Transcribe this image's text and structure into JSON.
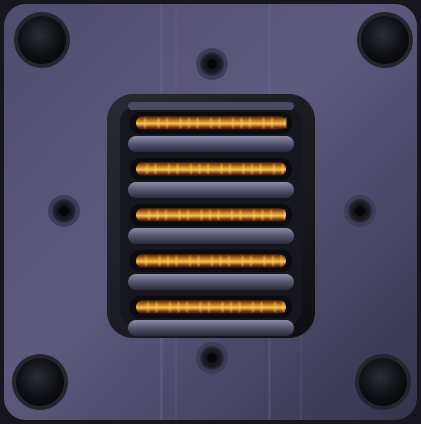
{
  "scene": {
    "subject": "ribbon-tweeter-faceplate",
    "colors": {
      "background": "#14141a",
      "plate_light": "#5d5a7e",
      "plate_dark": "#2b2c42",
      "recess": "#101015",
      "ribbon_glow": "#f0a21f",
      "ribbon_hot": "#ffd35a",
      "screw_head": "#0b0c10"
    },
    "large_corner_screws": 4,
    "small_mount_screws": 4,
    "ribbon_slots": 5
  }
}
